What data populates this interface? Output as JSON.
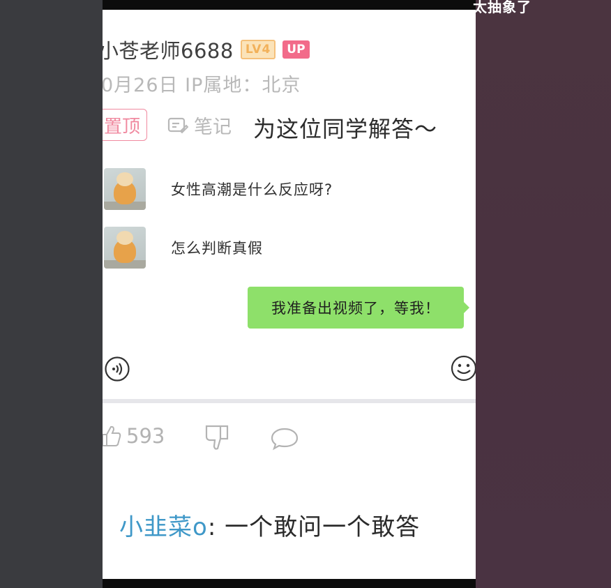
{
  "overlay": {
    "text": "太抽象了"
  },
  "post": {
    "username": "小苍老师6688",
    "level_badge": "LV4",
    "up_badge": "UP",
    "meta": "0月26日  IP属地：北京",
    "pin_label": "置顶",
    "note_label": "笔记",
    "title": "为这位同学解答～"
  },
  "chat": {
    "messages": [
      {
        "side": "left",
        "text": "女性高潮是什么反应呀?"
      },
      {
        "side": "left",
        "text": "怎么判断真假"
      },
      {
        "side": "right",
        "text": "我准备出视频了，等我！"
      }
    ]
  },
  "actions": {
    "like_count": "593"
  },
  "comment": {
    "author": "小韭菜o",
    "separator": ": ",
    "text": "一个敢问一个敢答"
  }
}
